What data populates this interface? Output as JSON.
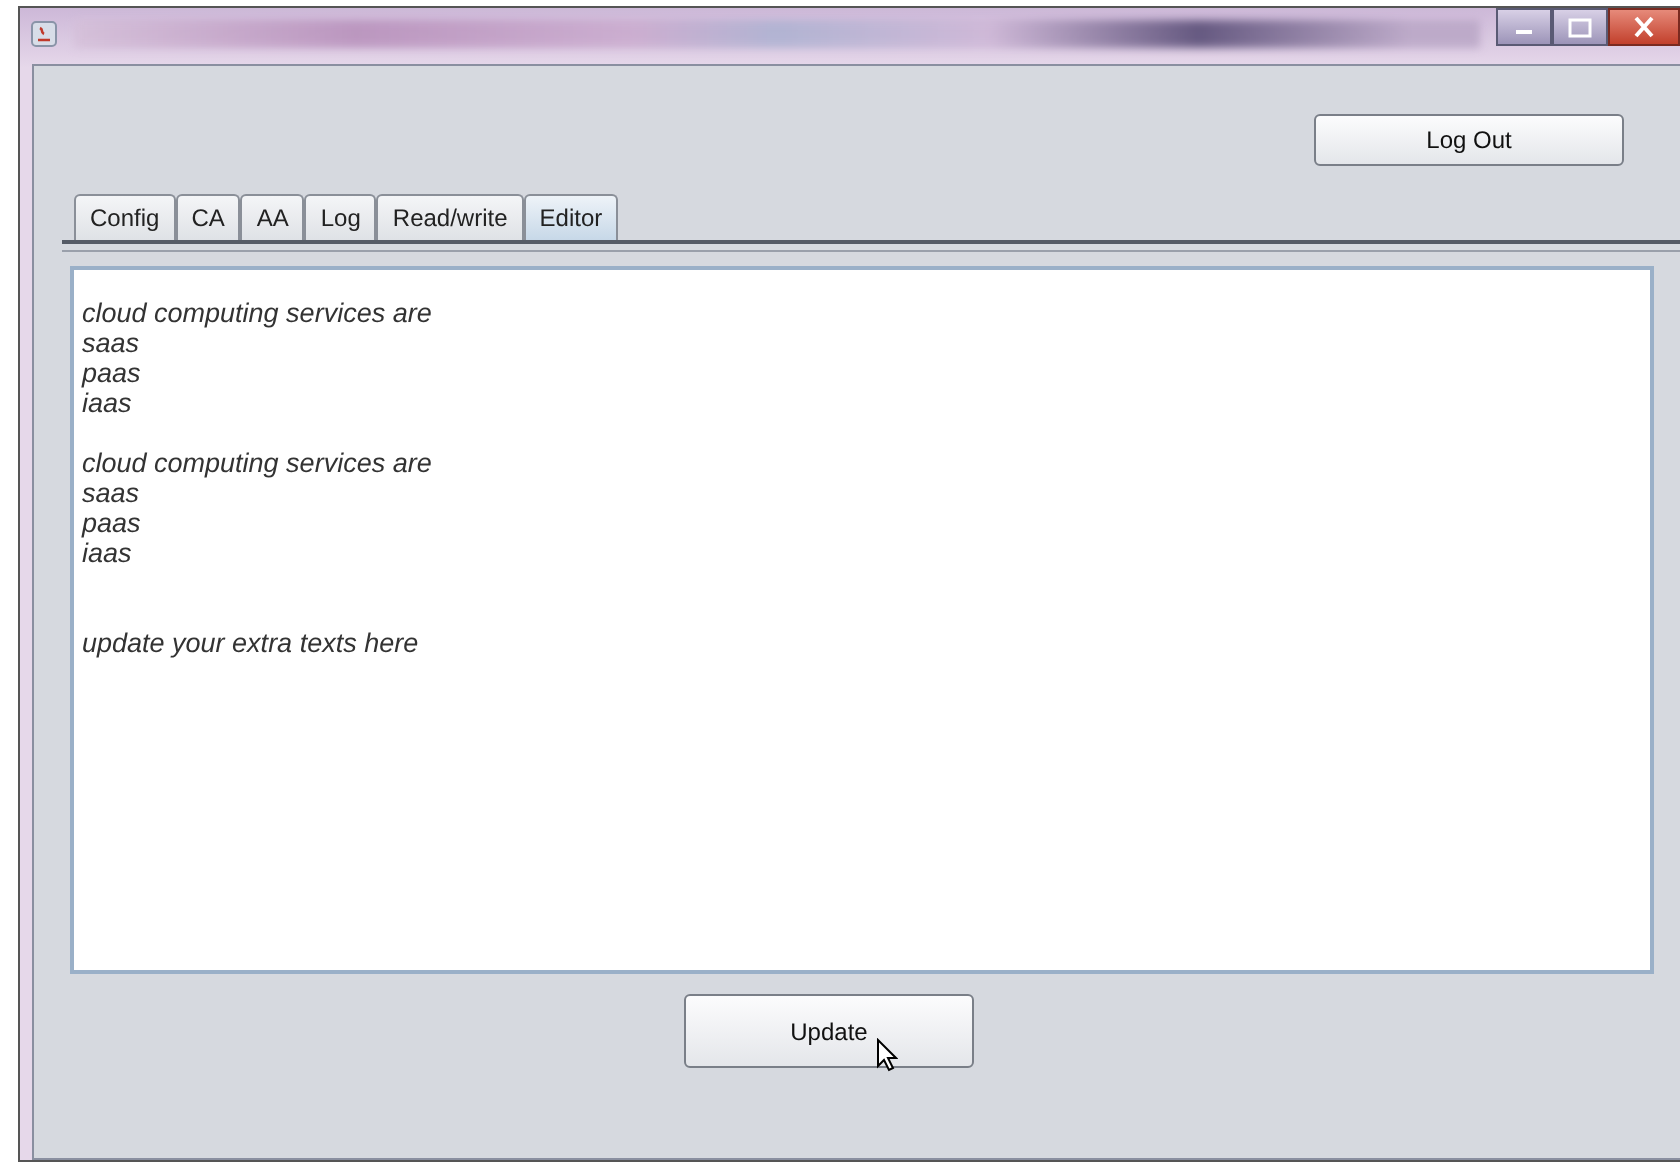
{
  "logout_button": "Log Out",
  "tabs": [
    {
      "label": "Config",
      "selected": false
    },
    {
      "label": "CA",
      "selected": false
    },
    {
      "label": "AA",
      "selected": false
    },
    {
      "label": "Log",
      "selected": false
    },
    {
      "label": "Read/write",
      "selected": false
    },
    {
      "label": "Editor",
      "selected": true
    }
  ],
  "editor": {
    "lines": [
      {
        "kind": "text",
        "text": "cloud computing services are"
      },
      {
        "kind": "text",
        "text": "saas"
      },
      {
        "kind": "text",
        "text": "paas"
      },
      {
        "kind": "text",
        "text": "iaas"
      },
      {
        "kind": "blank"
      },
      {
        "kind": "text",
        "text": "cloud computing services are"
      },
      {
        "kind": "text",
        "text": "saas"
      },
      {
        "kind": "text",
        "text": "paas"
      },
      {
        "kind": "text",
        "text": "iaas"
      },
      {
        "kind": "blank"
      },
      {
        "kind": "blank"
      },
      {
        "kind": "text",
        "text": "update your extra texts here"
      }
    ]
  },
  "update_button": "Update"
}
